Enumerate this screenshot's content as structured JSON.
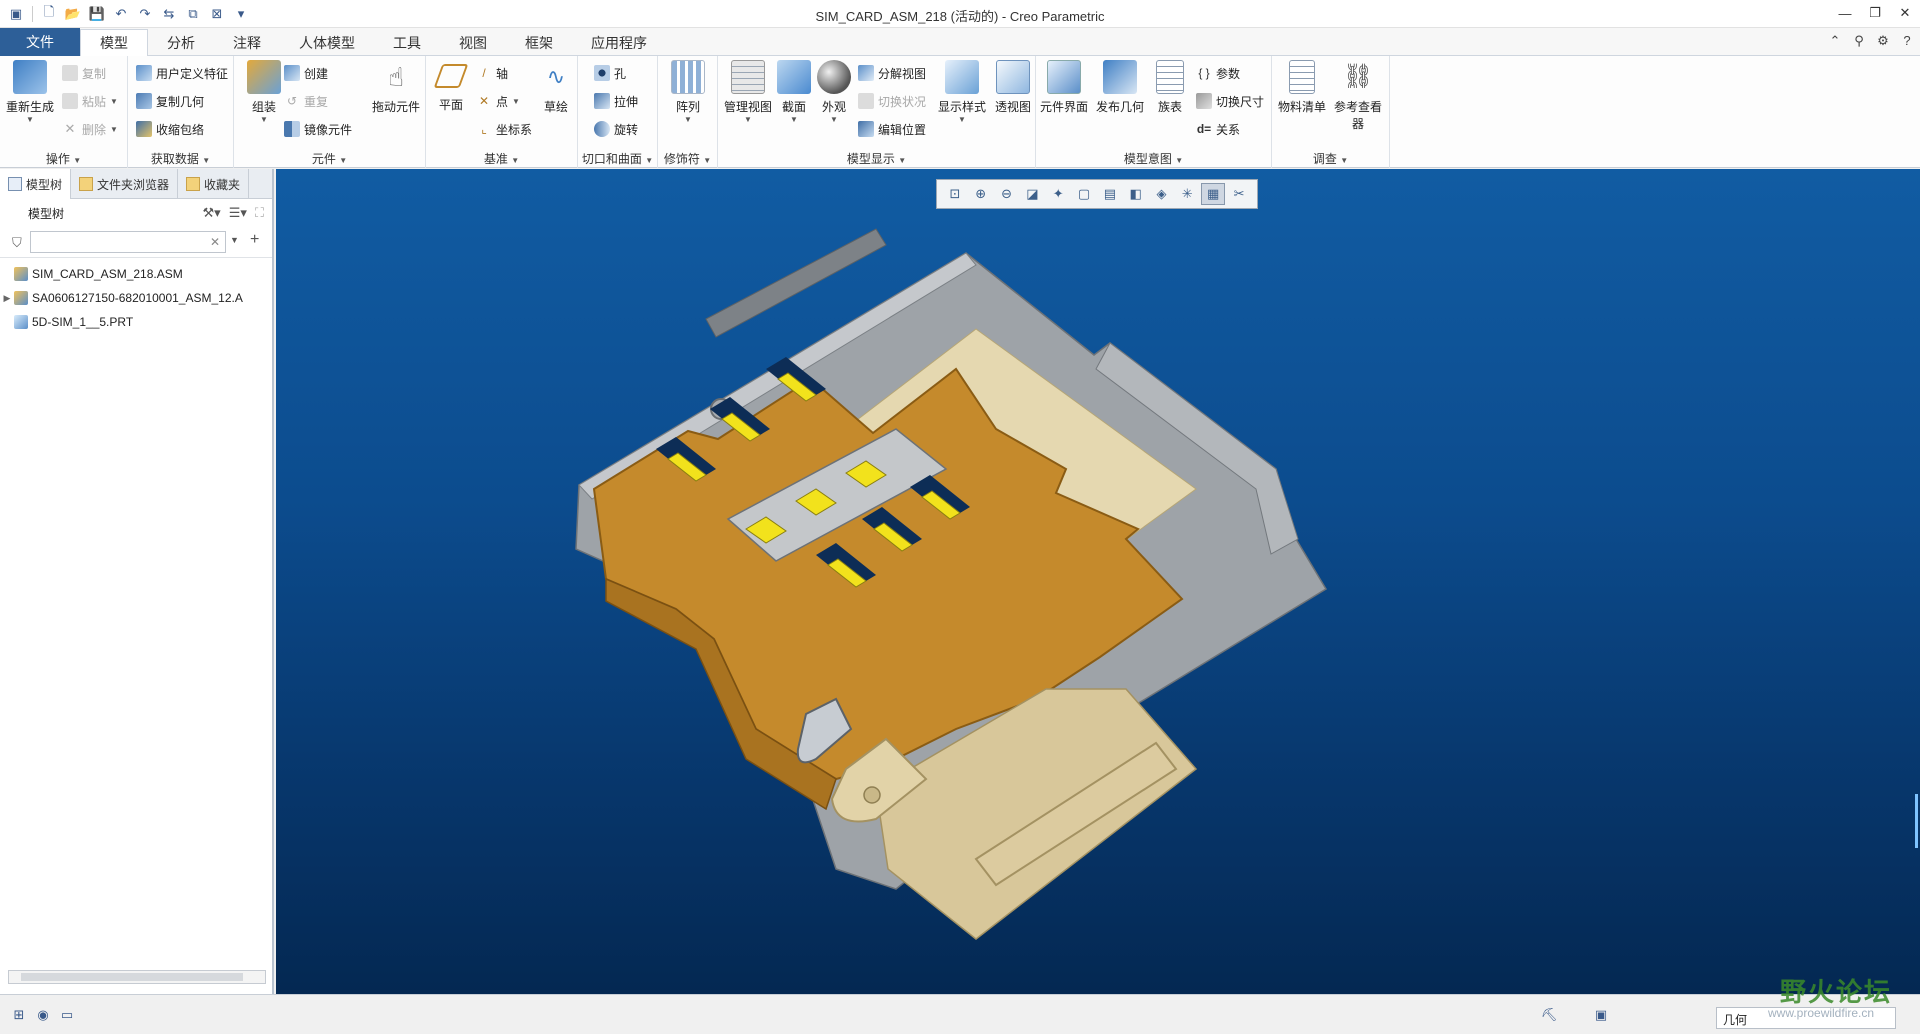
{
  "window": {
    "title": "SIM_CARD_ASM_218 (活动的) - Creo Parametric"
  },
  "tabs": [
    {
      "label": "文件"
    },
    {
      "label": "模型"
    },
    {
      "label": "分析"
    },
    {
      "label": "注释"
    },
    {
      "label": "人体模型"
    },
    {
      "label": "工具"
    },
    {
      "label": "视图"
    },
    {
      "label": "框架"
    },
    {
      "label": "应用程序"
    }
  ],
  "ribbon": {
    "groups": {
      "operations": {
        "label": "操作",
        "regenerate": "重新生成",
        "copy": "复制",
        "paste": "粘贴",
        "delete": "删除"
      },
      "get_data": {
        "label": "获取数据",
        "udf": "用户定义特征",
        "copy_geom": "复制几何",
        "shrinkwrap": "收缩包络"
      },
      "component": {
        "label": "元件",
        "assemble": "组装",
        "create": "创建",
        "repeat": "重复",
        "mirror": "镜像元件",
        "drag": "拖动元件"
      },
      "datum": {
        "label": "基准",
        "plane": "平面",
        "axis": "轴",
        "point": "点",
        "csys": "坐标系",
        "sketch": "草绘"
      },
      "cut_surface": {
        "label": "切口和曲面",
        "hole": "孔",
        "extrude": "拉伸",
        "revolve": "旋转"
      },
      "modifiers": {
        "label": "修饰符",
        "pattern": "阵列"
      },
      "model_display": {
        "label": "模型显示",
        "manage_views": "管理视图",
        "section": "截面",
        "appearance": "外观",
        "explode": "分解视图",
        "toggle_state": "切换状况",
        "edit_position": "编辑位置",
        "display_style": "显示样式",
        "perspective": "透视图"
      },
      "model_intent": {
        "label": "模型意图",
        "component_interface": "元件界面",
        "publish_geom": "发布几何",
        "family_table": "族表",
        "parameters": "参数",
        "switch_dims": "切换尺寸",
        "relations": "关系"
      },
      "investigate": {
        "label": "调查",
        "bom": "物料清单",
        "reference_viewer": "参考查看器"
      }
    }
  },
  "left_panel": {
    "tabs": [
      {
        "label": "模型树"
      },
      {
        "label": "文件夹浏览器"
      },
      {
        "label": "收藏夹"
      }
    ],
    "tree_title": "模型树",
    "filter_value": "",
    "tree_items": [
      {
        "label": "SIM_CARD_ASM_218.ASM"
      },
      {
        "label": "SA0606127150-682010001_ASM_12.A"
      },
      {
        "label": "5D-SIM_1__5.PRT"
      }
    ]
  },
  "status": {
    "selection_filter": "几何"
  },
  "watermark": {
    "name": "野火论坛",
    "url": "www.proewildfire.cn"
  },
  "colors": {
    "file_tab": "#2d5f98",
    "viewport_top": "#115ca3",
    "viewport_bottom": "#042852",
    "shell_orange": "#c58a2c",
    "housing_gray": "#9ea3a8",
    "tray_beige": "#d8c79a",
    "contact_yellow": "#f2e21c"
  }
}
